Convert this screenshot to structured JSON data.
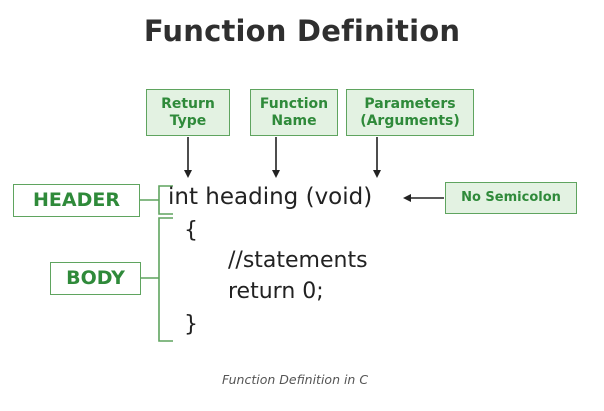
{
  "title": "Function Definition",
  "labels": {
    "return_type_line1": "Return",
    "return_type_line2": "Type",
    "function_name_line1": "Function",
    "function_name_line2": "Name",
    "parameters_line1": "Parameters",
    "parameters_line2": "(Arguments)",
    "no_semicolon": "No Semicolon",
    "header": "HEADER",
    "body": "BODY"
  },
  "code": {
    "signature": "int heading (void)",
    "open_brace": "{",
    "statements": "//statements",
    "return_stmt": "return 0;",
    "close_brace": "}"
  },
  "caption": "Function Definition in C",
  "colors": {
    "label_fill": "#e3f2e2",
    "label_border": "#5fa45f",
    "label_text": "#2f8a3a",
    "code_text": "#222222",
    "title_text": "#2f2f2f"
  }
}
